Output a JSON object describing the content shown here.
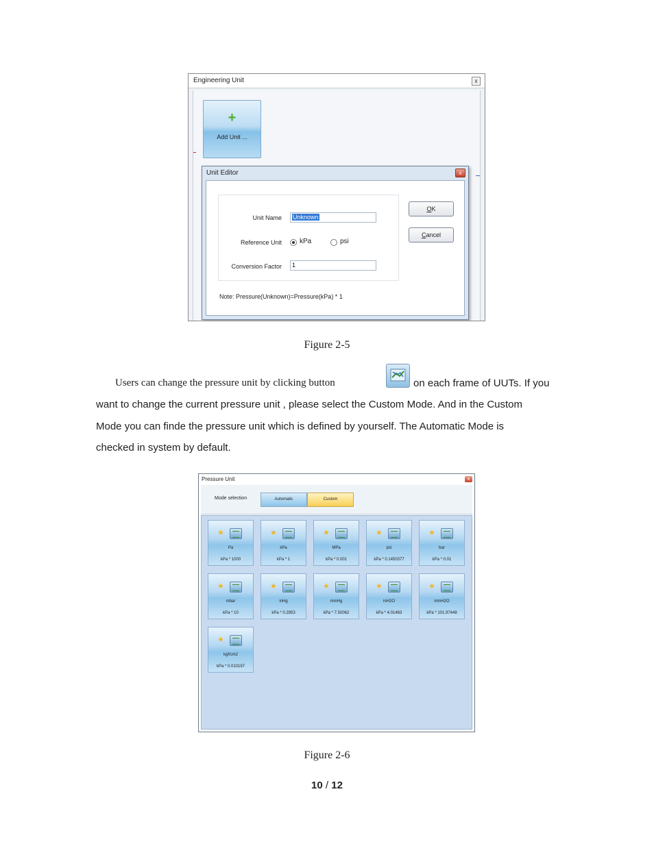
{
  "figure1": {
    "window_title": "Engineering Unit",
    "close_glyph": "x",
    "add_unit": {
      "plus": "+",
      "label": "Add Unit ..."
    },
    "editor": {
      "title": "Unit Editor",
      "close_glyph": "x",
      "unit_name_label": "Unit Name",
      "unit_name_value": "Unknown",
      "reference_unit_label": "Reference Unit",
      "radio_kpa": "kPa",
      "radio_psi": "psi",
      "selected_reference": "kPa",
      "conversion_factor_label": "Conversion Factor",
      "conversion_factor_value": "1",
      "ok_label": "OK",
      "cancel_label": "Cancel",
      "note": "Note: Pressure(Unknown)=Pressure(kPa) * 1"
    }
  },
  "captions": {
    "fig1": "Figure 2-5",
    "fig2": "Figure 2-6"
  },
  "paragraph": {
    "line1a": "Users can change the pressure unit by clicking button",
    "line1b": "on each frame of UUTs. If you",
    "line2": "want to change the current pressure unit , please select the Custom Mode. And in the Custom",
    "line3": "Mode you can finde the pressure unit which is defined by yourself.  The Automatic Mode is",
    "line4": "checked in system by default."
  },
  "figure2": {
    "window_title": "Pressure Unit",
    "close_glyph": "x",
    "mode_label": "Mode selection",
    "automatic_label": "Automatic",
    "custom_label": "Custom",
    "units": [
      {
        "name": "Pa",
        "factor": "kPa * 1000"
      },
      {
        "name": "kPa",
        "factor": "kPa * 1"
      },
      {
        "name": "MPa",
        "factor": "kPa * 0.001"
      },
      {
        "name": "psi",
        "factor": "kPa * 0.1450377"
      },
      {
        "name": "bar",
        "factor": "kPa * 0.01"
      },
      {
        "name": "mbar",
        "factor": "kPa * 10"
      },
      {
        "name": "inHg",
        "factor": "kPa * 0.2953"
      },
      {
        "name": "mmHg",
        "factor": "kPa * 7.50062"
      },
      {
        "name": "inH2O",
        "factor": "kPa * 4.01463"
      },
      {
        "name": "mmH2O",
        "factor": "kPa * 101.97448"
      },
      {
        "name": "kgf/cm2",
        "factor": "kPa * 0.010197"
      }
    ]
  },
  "page_number": {
    "current": "10",
    "separator": " / ",
    "total": "12"
  }
}
